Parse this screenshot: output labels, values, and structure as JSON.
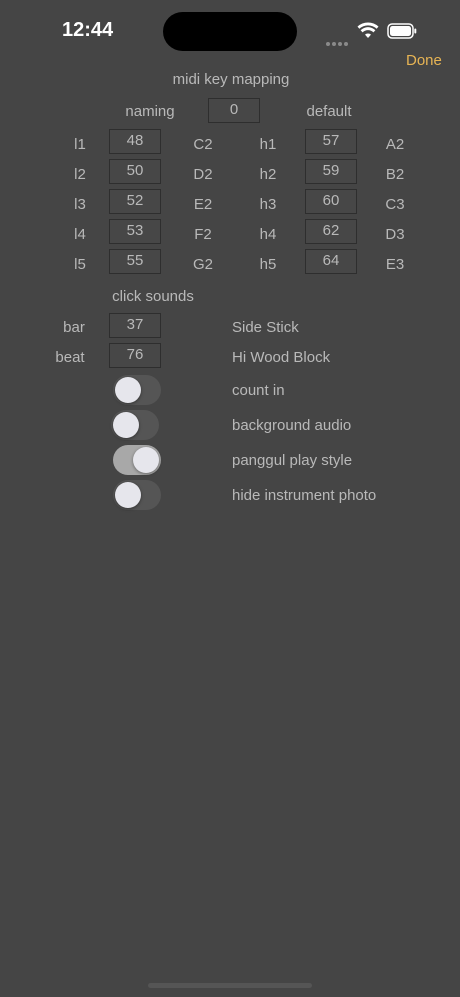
{
  "status_bar": {
    "time": "12:44"
  },
  "nav": {
    "done_label": "Done"
  },
  "title": "midi key mapping",
  "naming": {
    "label": "naming",
    "value": "0",
    "default_label": "default"
  },
  "low_keys": [
    {
      "label": "l1",
      "value": "48",
      "note": "C2"
    },
    {
      "label": "l2",
      "value": "50",
      "note": "D2"
    },
    {
      "label": "l3",
      "value": "52",
      "note": "E2"
    },
    {
      "label": "l4",
      "value": "53",
      "note": "F2"
    },
    {
      "label": "l5",
      "value": "55",
      "note": "G2"
    }
  ],
  "high_keys": [
    {
      "label": "h1",
      "value": "57",
      "note": "A2"
    },
    {
      "label": "h2",
      "value": "59",
      "note": "B2"
    },
    {
      "label": "h3",
      "value": "60",
      "note": "C3"
    },
    {
      "label": "h4",
      "value": "62",
      "note": "D3"
    },
    {
      "label": "h5",
      "value": "64",
      "note": "E3"
    }
  ],
  "click_sounds": {
    "title": "click sounds",
    "bar": {
      "label": "bar",
      "value": "37",
      "sound": "Side Stick"
    },
    "beat": {
      "label": "beat",
      "value": "76",
      "sound": "Hi Wood Block"
    }
  },
  "toggles": [
    {
      "label": "count in",
      "on": false
    },
    {
      "label": "background audio",
      "on": false
    },
    {
      "label": "panggul play style",
      "on": true
    },
    {
      "label": "hide instrument photo",
      "on": false
    }
  ]
}
